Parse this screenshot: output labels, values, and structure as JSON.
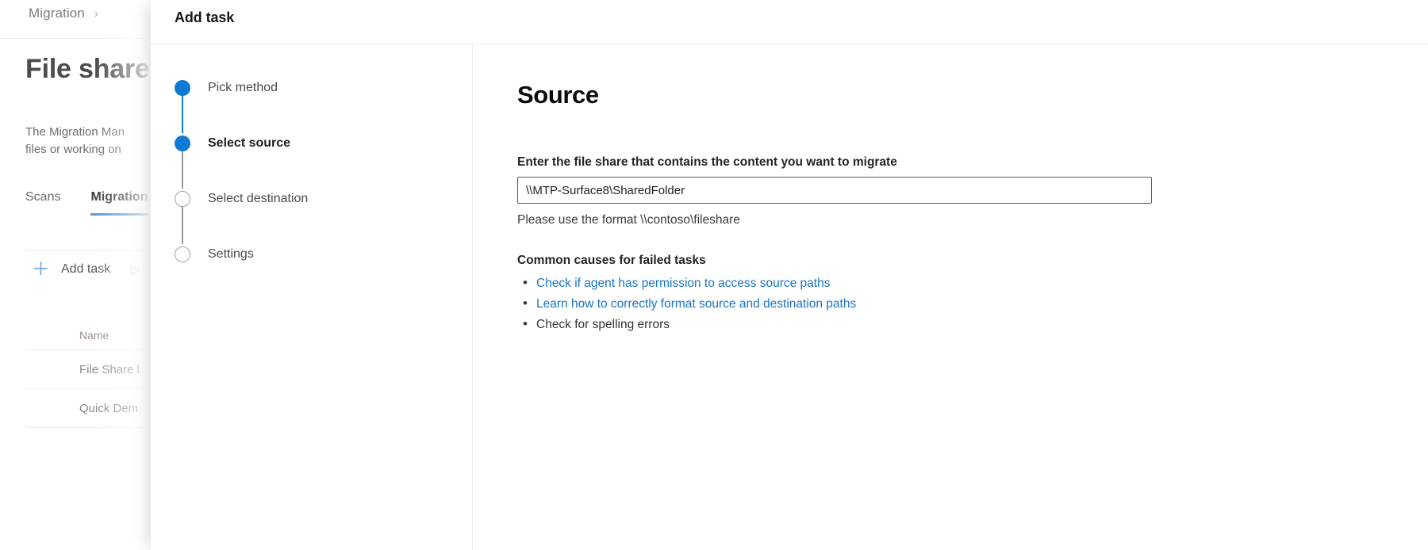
{
  "background": {
    "breadcrumb": {
      "label": "Migration",
      "chevron_icon": "chevron-right-icon",
      "chevron_glyph": "›"
    },
    "page_title": "File share",
    "description": "The Migration Man\nfiles or working on",
    "tabs": [
      {
        "label": "Scans",
        "active": false
      },
      {
        "label": "Migration",
        "active": true
      }
    ],
    "command_bar": {
      "add_task_label": "Add task",
      "add_icon": "plus-icon",
      "add_glyph": "＋",
      "run_icon": "play-icon",
      "run_glyph": "▷"
    },
    "table": {
      "columns": [
        "Name"
      ],
      "rows": [
        {
          "name": "File Share l"
        },
        {
          "name": "Quick Dem"
        }
      ]
    }
  },
  "panel": {
    "title": "Add task",
    "steps": [
      {
        "label": "Pick method",
        "state": "done",
        "bold": false
      },
      {
        "label": "Select source",
        "state": "current",
        "bold": true
      },
      {
        "label": "Select destination",
        "state": "todo",
        "bold": false
      },
      {
        "label": "Settings",
        "state": "todo",
        "bold": false
      }
    ],
    "content": {
      "heading": "Source",
      "field_label": "Enter the file share that contains the content you want to migrate",
      "field_value": "\\\\MTP-Surface8\\SharedFolder",
      "field_placeholder": "\\\\contoso\\fileshare",
      "field_hint": "Please use the format \\\\contoso\\fileshare",
      "causes_title": "Common causes for failed tasks",
      "causes": [
        {
          "text": "Check if agent has permission to access source paths",
          "link": true
        },
        {
          "text": "Learn how to correctly format source and destination paths",
          "link": true
        },
        {
          "text": "Check for spelling errors",
          "link": false
        }
      ]
    }
  },
  "colors": {
    "accent_blue": "#0f7ad4",
    "link_blue": "#1a74c4",
    "tab_underline": "#5b9bd5",
    "step_todo_outline": "#a3a3a3"
  }
}
